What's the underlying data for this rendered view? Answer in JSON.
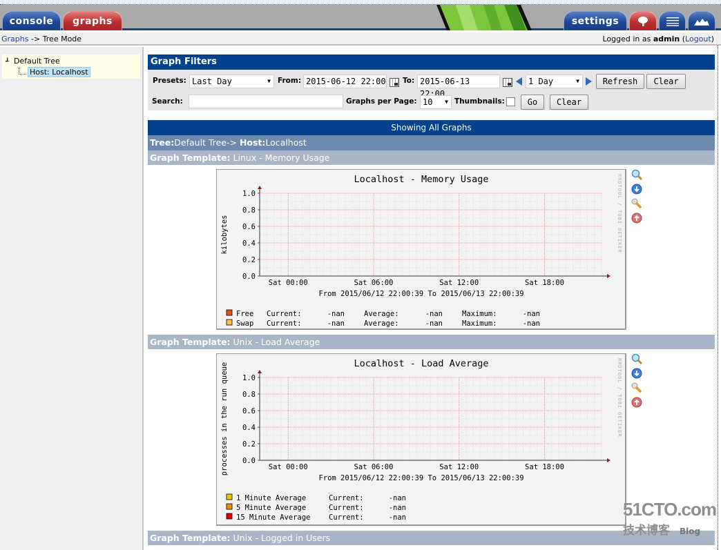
{
  "header": {
    "tabs": [
      {
        "label": "console",
        "color": "#1e4796"
      },
      {
        "label": "graphs",
        "color": "#bb2e2e"
      },
      {
        "label": "settings",
        "color": "#1e4796"
      }
    ],
    "icon_tabs": [
      "tree-view-icon",
      "list-view-icon",
      "preview-view-icon"
    ]
  },
  "breadcrumb": {
    "link": "Graphs",
    "separator": " -> ",
    "current": "Tree Mode"
  },
  "login": {
    "prefix": "Logged in as ",
    "user": "admin",
    "logout": "Logout"
  },
  "tree": {
    "root": "Default Tree",
    "leaf": "Host: Localhost"
  },
  "filters": {
    "title": "Graph Filters",
    "presets_label": "Presets:",
    "presets_value": "Last Day",
    "from_label": "From:",
    "from_value": "2015-06-12 22:00",
    "to_label": "To:",
    "to_value": "2015-06-13 22:00",
    "timespan_value": "1 Day",
    "refresh_label": "Refresh",
    "clear_label": "Clear",
    "search_label": "Search:",
    "search_value": "",
    "per_page_label": "Graphs per Page:",
    "per_page_value": "10",
    "thumbnails_label": "Thumbnails:",
    "thumbnails_checked": false,
    "go_label": "Go",
    "clear2_label": "Clear"
  },
  "showing": "Showing All Graphs",
  "tree_header": {
    "tree_label": "Tree:",
    "tree_value": "Default Tree-> ",
    "host_label": "Host:",
    "host_value": "Localhost"
  },
  "graph_sections": [
    {
      "template_label": "Graph Template:",
      "template_value": "Linux - Memory Usage"
    },
    {
      "template_label": "Graph Template:",
      "template_value": "Unix - Load Average"
    },
    {
      "template_label": "Graph Template:",
      "template_value": "Unix - Logged in Users"
    }
  ],
  "graph_action_icons": [
    "zoom-icon",
    "csv-export-icon",
    "edit-graph-icon",
    "back-to-top-icon"
  ],
  "rrd_credit": "RRDTOOL / TOBI OETIKER",
  "chart_data": [
    {
      "type": "line",
      "title": "Localhost - Memory Usage",
      "ylabel": "kilobytes",
      "xlabel": "",
      "ylim": [
        0,
        1.0
      ],
      "yticks": [
        "0.0",
        "0.2",
        "0.4",
        "0.6",
        "0.8",
        "1.0"
      ],
      "xticks": [
        "Sat 00:00",
        "Sat 06:00",
        "Sat 12:00",
        "Sat 18:00"
      ],
      "grid": true,
      "period": "From 2015/06/12 22:00:39 To 2015/06/13 22:00:39",
      "series": [
        {
          "name": "Free",
          "color": "#e8501a",
          "values": [],
          "current": "-nan",
          "average": "-nan",
          "maximum": "-nan"
        },
        {
          "name": "Swap",
          "color": "#f7c34a",
          "values": [],
          "current": "-nan",
          "average": "-nan",
          "maximum": "-nan"
        }
      ],
      "legend_labels": {
        "current": "Current:",
        "average": "Average:",
        "maximum": "Maximum:"
      }
    },
    {
      "type": "line",
      "title": "Localhost - Load Average",
      "ylabel": "processes in the run queue",
      "xlabel": "",
      "ylim": [
        0,
        1.0
      ],
      "yticks": [
        "0.0",
        "0.2",
        "0.4",
        "0.6",
        "0.8",
        "1.0"
      ],
      "xticks": [
        "Sat 00:00",
        "Sat 06:00",
        "Sat 12:00",
        "Sat 18:00"
      ],
      "grid": true,
      "period": "From 2015/06/12 22:00:39 To 2015/06/13 22:00:39",
      "series": [
        {
          "name": "1 Minute Average",
          "color": "#f0c800",
          "values": [],
          "current": "-nan"
        },
        {
          "name": "5 Minute Average",
          "color": "#e8900a",
          "values": [],
          "current": "-nan"
        },
        {
          "name": "15 Minute Average",
          "color": "#e00000",
          "values": [],
          "current": "-nan"
        }
      ],
      "legend_labels": {
        "current": "Current:"
      }
    }
  ],
  "watermark": {
    "site": "51CTO.com",
    "sub": "技术博客",
    "blog": "Blog"
  }
}
